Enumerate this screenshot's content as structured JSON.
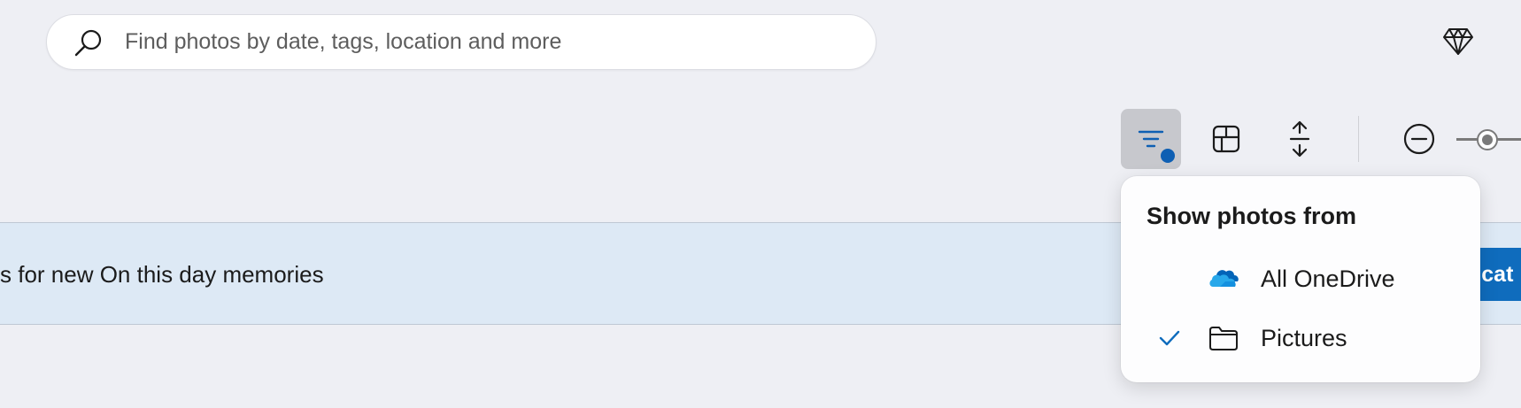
{
  "search": {
    "placeholder": "Find photos by date, tags, location and more",
    "icon": "search-icon"
  },
  "header": {
    "premium_icon": "diamond-icon"
  },
  "toolbar": {
    "filter_icon": "filter-icon",
    "filter_active": true,
    "layout_icon": "grid-layout-icon",
    "spacing_icon": "vertical-spacing-icon",
    "zoom_out_icon": "zoom-out-icon",
    "zoom_slider": "zoom-slider"
  },
  "banner": {
    "text": "s for new On this day memories",
    "button_label": "ficat"
  },
  "flyout": {
    "title": "Show photos from",
    "items": [
      {
        "label": "All OneDrive",
        "icon": "onedrive-cloud-icon",
        "checked": false
      },
      {
        "label": "Pictures",
        "icon": "folder-icon",
        "checked": true
      }
    ]
  },
  "colors": {
    "background": "#eeeff4",
    "accent": "#0f6cbd",
    "banner": "#dde9f5",
    "filter_dot": "#0e5fb3",
    "check": "#0f6cbd"
  }
}
